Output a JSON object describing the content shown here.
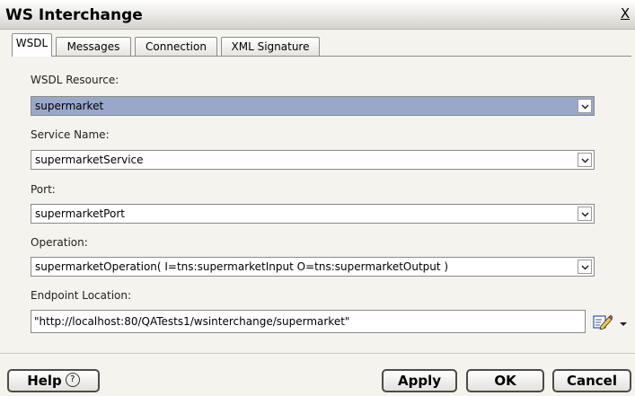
{
  "window": {
    "title": "WS Interchange",
    "close_glyph": "X"
  },
  "tabs": [
    {
      "label": "WSDL",
      "active": true
    },
    {
      "label": "Messages",
      "active": false
    },
    {
      "label": "Connection",
      "active": false
    },
    {
      "label": "XML Signature",
      "active": false
    }
  ],
  "fields": {
    "wsdl_resource": {
      "label": "WSDL Resource:",
      "value": "supermarket"
    },
    "service_name": {
      "label": "Service Name:",
      "value": "supermarketService"
    },
    "port": {
      "label": "Port:",
      "value": "supermarketPort"
    },
    "operation": {
      "label": "Operation:",
      "value": "supermarketOperation( I=tns:supermarketInput O=tns:supermarketOutput )"
    },
    "endpoint_location": {
      "label": "Endpoint Location:",
      "value": "\"http://localhost:80/QATests1/wsinterchange/supermarket\""
    }
  },
  "buttons": {
    "help": "Help",
    "help_glyph": "?",
    "apply": "Apply",
    "ok": "OK",
    "cancel": "Cancel"
  },
  "icons": {
    "close": "close-icon",
    "dropdown": "chevron-down-icon",
    "edit": "edit-pencil-icon",
    "help": "question-circle-icon"
  },
  "colors": {
    "selected_field": "#99a8c9",
    "dialog_bg": "#f4f3ee"
  }
}
